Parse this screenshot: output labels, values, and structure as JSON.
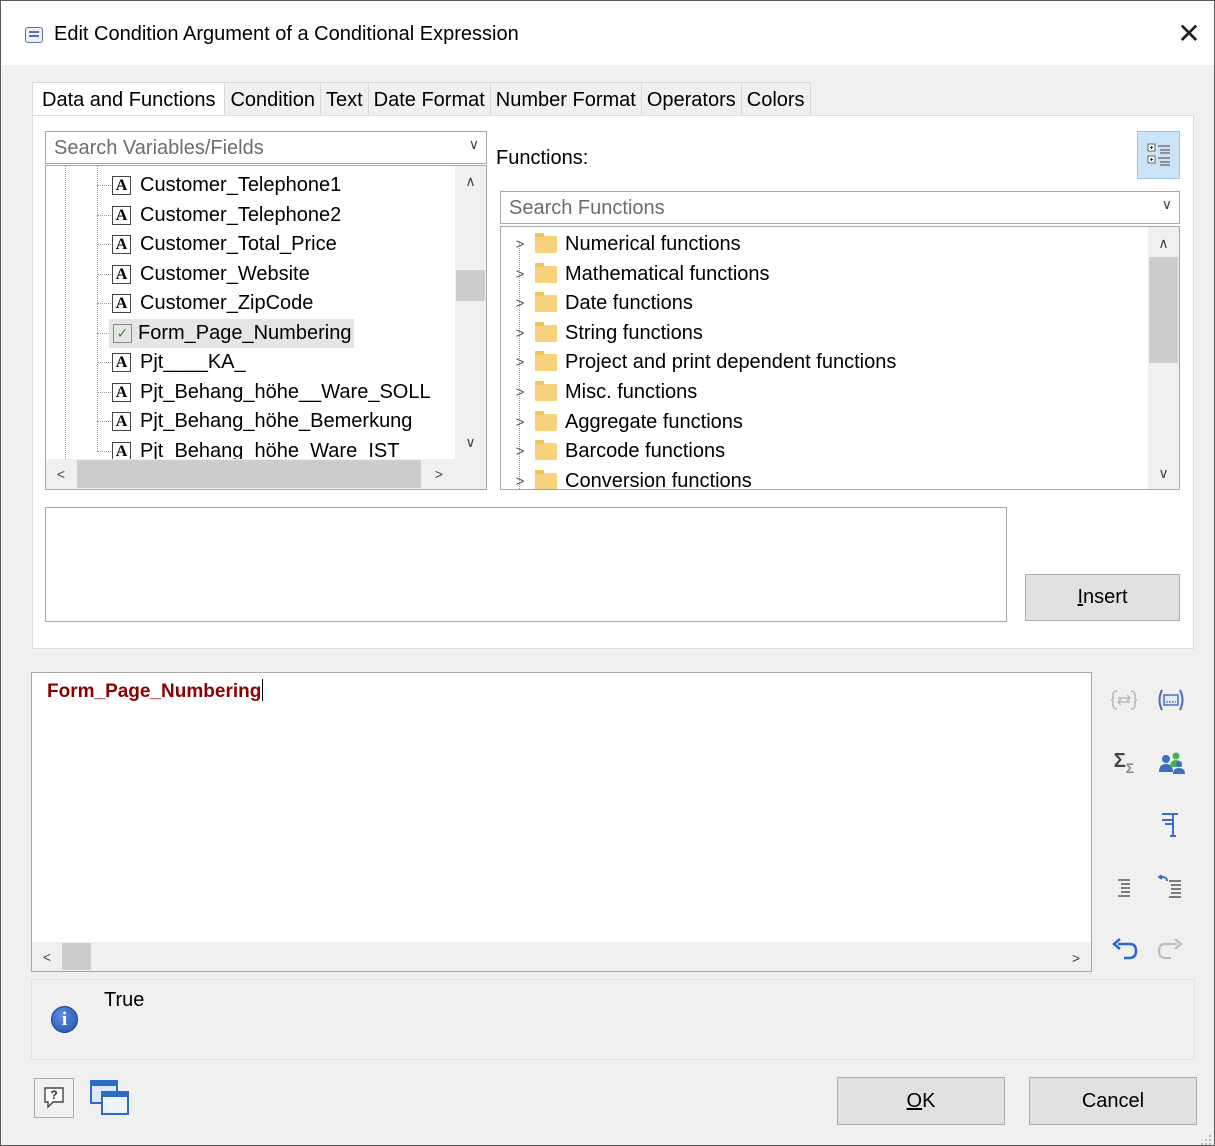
{
  "window": {
    "title": "Edit Condition Argument of a Conditional Expression",
    "close_label": "✕"
  },
  "tabs": [
    "Data and Functions",
    "Condition",
    "Text",
    "Date Format",
    "Number Format",
    "Operators",
    "Colors"
  ],
  "variables": {
    "search_placeholder": "Search Variables/Fields",
    "items": [
      {
        "label": "Customer_Telephone1",
        "icon": "text-field-icon"
      },
      {
        "label": "Customer_Telephone2",
        "icon": "text-field-icon"
      },
      {
        "label": "Customer_Total_Price",
        "icon": "text-field-icon"
      },
      {
        "label": "Customer_Website",
        "icon": "text-field-icon"
      },
      {
        "label": "Customer_ZipCode",
        "icon": "text-field-icon"
      },
      {
        "label": "Form_Page_Numbering",
        "icon": "boolean-field-icon",
        "selected": true
      },
      {
        "label": "Pjt____KA_",
        "icon": "text-field-icon"
      },
      {
        "label": "Pjt_Behang_höhe__Ware_SOLL",
        "icon": "text-field-icon"
      },
      {
        "label": "Pjt_Behang_höhe_Bemerkung",
        "icon": "text-field-icon"
      },
      {
        "label": "Pjt_Behang_höhe_Ware_IST",
        "icon": "text-field-icon"
      }
    ]
  },
  "functions": {
    "label": "Functions:",
    "search_placeholder": "Search Functions",
    "categories": [
      "Numerical functions",
      "Mathematical functions",
      "Date functions",
      "String functions",
      "Project and print dependent functions",
      "Misc. functions",
      "Aggregate functions",
      "Barcode functions",
      "Conversion functions"
    ]
  },
  "insert_button": {
    "prefix": "",
    "accel": "I",
    "rest": "nsert"
  },
  "editor": {
    "expression": "Form_Page_Numbering"
  },
  "result": {
    "text": "True"
  },
  "ok_button": {
    "accel": "O",
    "rest": "K"
  },
  "cancel_button": {
    "label": "Cancel"
  },
  "colors": {
    "accent": "#cce4f7",
    "expression": "#8b0000",
    "info": "#1e4fa8"
  }
}
